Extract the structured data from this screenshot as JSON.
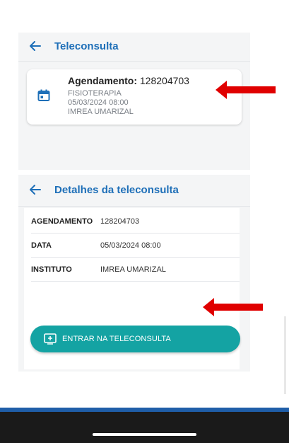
{
  "screen1": {
    "title": "Teleconsulta",
    "card": {
      "label": "Agendamento:",
      "number": "128204703",
      "specialty": "FISIOTERAPIA",
      "datetime": "05/03/2024 08:00",
      "institute": "IMREA UMARIZAL"
    }
  },
  "screen2": {
    "title": "Detalhes da teleconsulta",
    "rows": [
      {
        "key": "AGENDAMENTO",
        "value": "128204703"
      },
      {
        "key": "DATA",
        "value": "05/03/2024 08:00"
      },
      {
        "key": "INSTITUTO",
        "value": "IMREA UMARIZAL"
      }
    ],
    "button_label": "ENTRAR NA TELECONSULTA"
  },
  "colors": {
    "primary_blue": "#1e6fb8",
    "teal": "#14a3a3",
    "red_annotation": "#e00000"
  },
  "icons": [
    "back-arrow-icon",
    "calendar-icon",
    "plus-box-icon",
    "red-arrow-annotation"
  ]
}
